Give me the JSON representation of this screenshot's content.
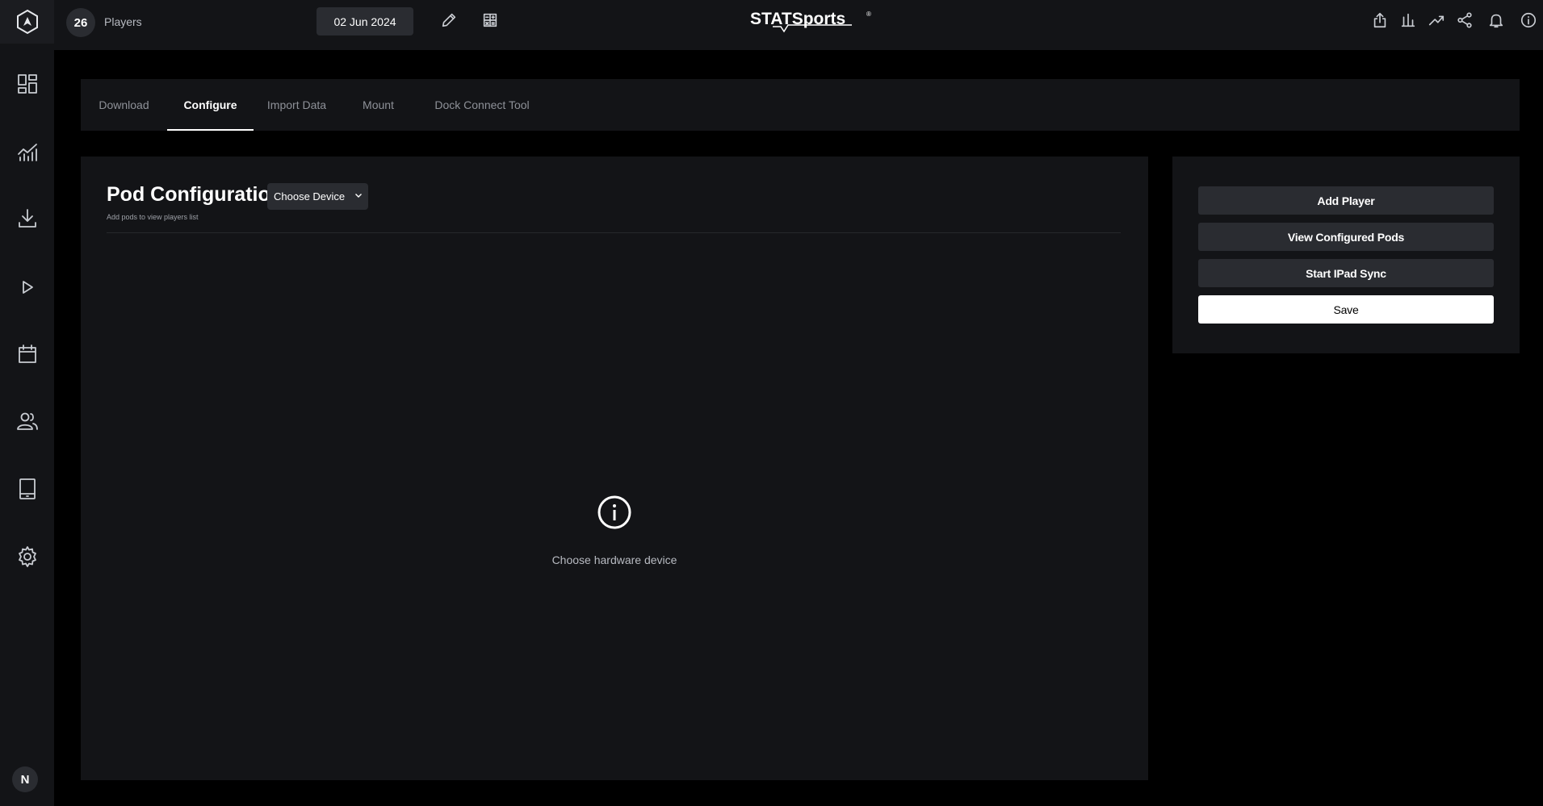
{
  "topbar": {
    "player_count": "26",
    "players_label": "Players",
    "date": "02 Jun 2024",
    "brand": "STATSports",
    "brand_mark": "®"
  },
  "sidebar": {
    "avatar_initial": "N",
    "items": [
      {
        "icon": "dashboard-icon"
      },
      {
        "icon": "analytics-icon"
      },
      {
        "icon": "download-icon"
      },
      {
        "icon": "play-icon"
      },
      {
        "icon": "calendar-icon"
      },
      {
        "icon": "users-icon"
      },
      {
        "icon": "tablet-icon"
      },
      {
        "icon": "gear-icon"
      }
    ]
  },
  "tabs": [
    {
      "label": "Download",
      "active": false
    },
    {
      "label": "Configure",
      "active": true
    },
    {
      "label": "Import Data",
      "active": false
    },
    {
      "label": "Mount",
      "active": false
    },
    {
      "label": "Dock Connect Tool",
      "active": false
    }
  ],
  "main": {
    "title": "Pod Configuration",
    "device_select": "Choose Device",
    "subtitle": "Add pods to view players list",
    "empty_message": "Choose hardware device"
  },
  "side": {
    "add_player": "Add Player",
    "view_pods": "View Configured Pods",
    "ipad_sync": "Start IPad Sync",
    "save": "Save"
  },
  "colors": {
    "background": "#000000",
    "panel": "#131417",
    "button": "#2a2c31",
    "text_muted": "#8e9198"
  }
}
